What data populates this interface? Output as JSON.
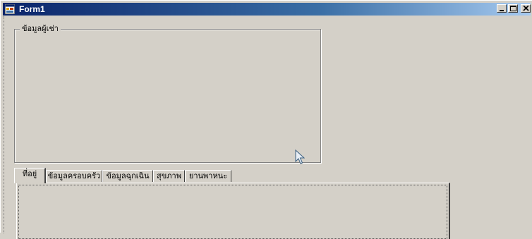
{
  "window": {
    "title": "Form1",
    "controls": {
      "minimize": "minimize",
      "maximize": "maximize",
      "close": "close"
    }
  },
  "groupbox": {
    "legend": "ข้อมูลผู้เช่า"
  },
  "tabs": [
    {
      "label": "ที่อยู่",
      "active": true
    },
    {
      "label": "ข้อมูลครอบครัว",
      "active": false
    },
    {
      "label": "ข้อมูลฉุกเฉิน",
      "active": false
    },
    {
      "label": "สุขภาพ",
      "active": false
    },
    {
      "label": "ยานพาหนะ",
      "active": false
    }
  ],
  "colors": {
    "face": "#d4d0c8",
    "titlebar_start": "#0a246a",
    "titlebar_end": "#a6caf0"
  },
  "icons": {
    "app": "form-icon",
    "cursor": "arrow-cursor-icon"
  }
}
